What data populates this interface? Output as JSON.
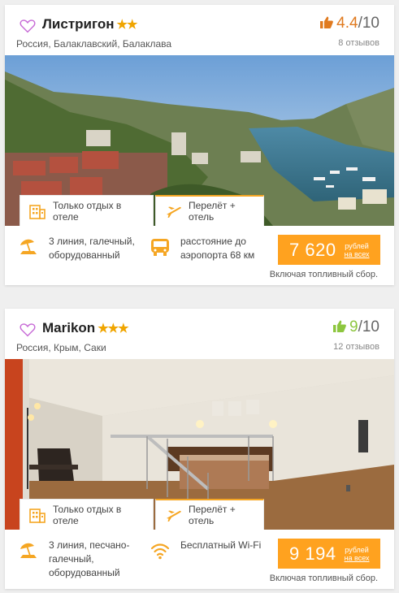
{
  "hotels": [
    {
      "name": "Листригон",
      "stars": "★★",
      "location": "Россия, Балаклавский, Балаклава",
      "rating_value": "4.4",
      "rating_max": "/10",
      "rating_color": "#e07a1f",
      "reviews": "8 отзывов",
      "tab_hotel": "Только отдых в отеле",
      "tab_flight": "Перелёт + отель",
      "feature1": "3 линия, галечный, оборудованный",
      "feature1_icon": "beach-umbrella-icon",
      "feature2": "расстояние до аэропорта 68 км",
      "feature2_icon": "bus-icon",
      "price": "7 620",
      "price_unit_1": "рублей",
      "price_unit_2": "на всех",
      "fuel_note": "Включая топливный сбор."
    },
    {
      "name": "Marikon",
      "stars": "★★★",
      "location": "Россия, Крым, Саки",
      "rating_value": "9",
      "rating_max": "/10",
      "rating_color": "#8dc63f",
      "reviews": "12 отзывов",
      "tab_hotel": "Только отдых в отеле",
      "tab_flight": "Перелёт + отель",
      "feature1": "3 линия, песчано-галечный, оборудованный",
      "feature1_icon": "beach-umbrella-icon",
      "feature2": "Бесплатный Wi-Fi",
      "feature2_icon": "wifi-icon",
      "price": "9 194",
      "price_unit_1": "рублей",
      "price_unit_2": "на всех",
      "fuel_note": "Включая топливный сбор."
    }
  ],
  "colors": {
    "accent": "#ffa21f",
    "heart": "#c86dd7",
    "stars": "#f0a500"
  }
}
